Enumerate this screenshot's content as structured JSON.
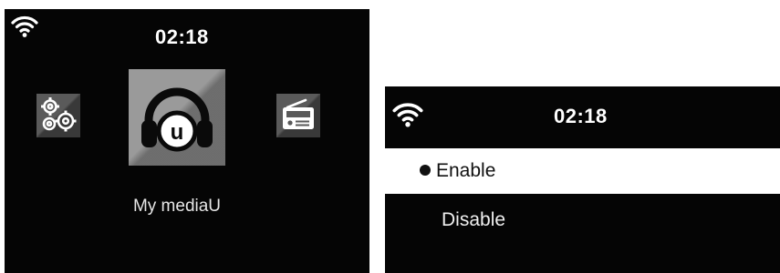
{
  "main_menu": {
    "status_bar": {
      "wifi_icon": "wifi-signal-icon",
      "time": "02:18"
    },
    "items": [
      {
        "id": "settings",
        "icon": "settings-gears-icon"
      },
      {
        "id": "media",
        "icon": "headphones-u-icon"
      },
      {
        "id": "radio",
        "icon": "radio-icon"
      }
    ],
    "selected_caption": "My mediaU"
  },
  "enable_menu": {
    "status_bar": {
      "wifi_icon": "wifi-signal-icon",
      "time": "02:18"
    },
    "options": [
      {
        "label": "Enable",
        "selected": true
      },
      {
        "label": "Disable",
        "selected": false
      }
    ]
  },
  "colors": {
    "screen_background": "#050505",
    "highlight_background": "#ffffff",
    "text_light": "#ffffff",
    "text_dark": "#111111"
  }
}
